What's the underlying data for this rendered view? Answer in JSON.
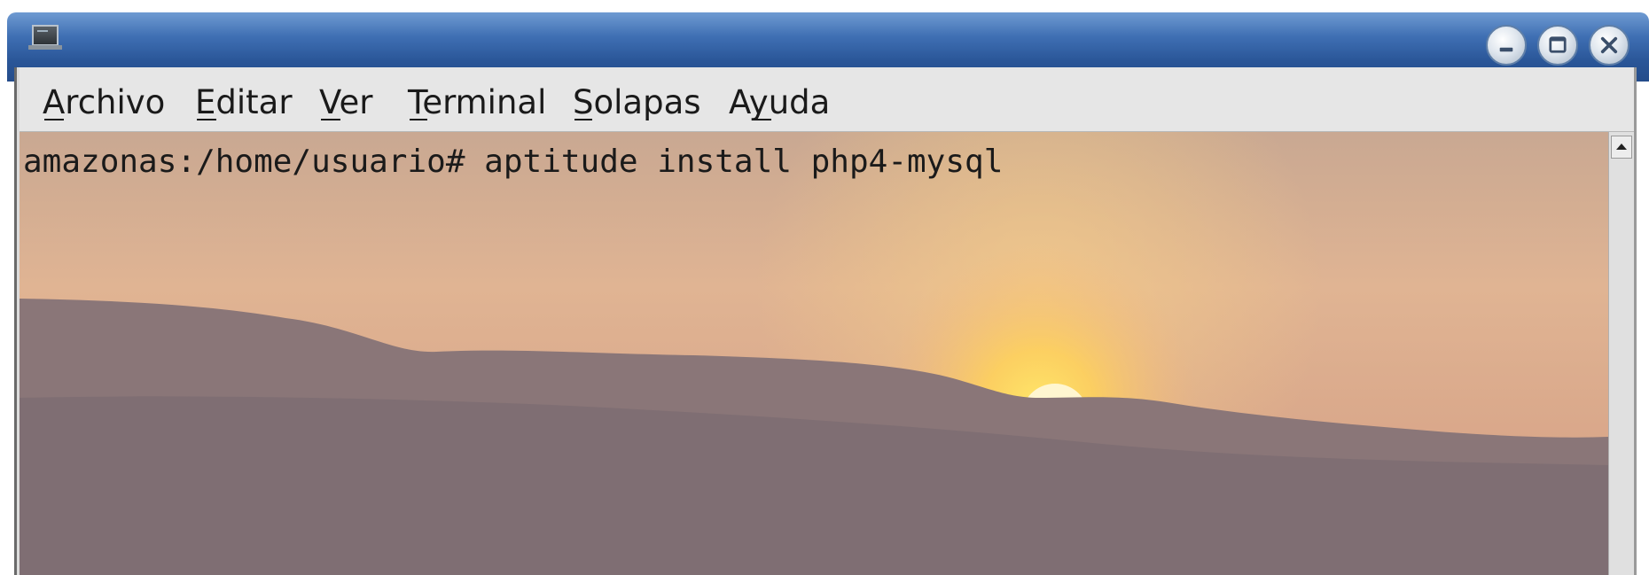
{
  "window": {
    "controls": {
      "minimize_icon": "minimize-icon",
      "maximize_icon": "maximize-icon",
      "close_icon": "close-icon"
    }
  },
  "menubar": {
    "items": [
      {
        "label": "Archivo",
        "mnemonic": "A"
      },
      {
        "label": "Editar",
        "mnemonic": "E"
      },
      {
        "label": "Ver",
        "mnemonic": "V"
      },
      {
        "label": "Terminal",
        "mnemonic": "T"
      },
      {
        "label": "Solapas",
        "mnemonic": "S"
      },
      {
        "label": "Ayuda",
        "mnemonic": "y"
      }
    ]
  },
  "terminal": {
    "lines": [
      "amazonas:/home/usuario# aptitude install php4-mysql"
    ]
  },
  "colors": {
    "titlebar": "#3f6fb3",
    "menubar": "#e6e6e6",
    "terminal_text": "#1a1a1a",
    "sky": "#d9ad8e",
    "sun": "#fff3c0"
  }
}
